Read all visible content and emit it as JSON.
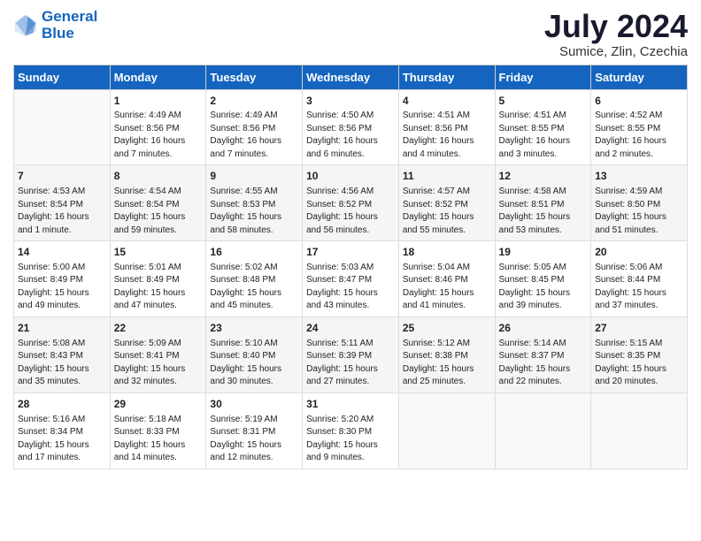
{
  "logo": {
    "line1": "General",
    "line2": "Blue"
  },
  "title": "July 2024",
  "subtitle": "Sumice, Zlin, Czechia",
  "weekdays": [
    "Sunday",
    "Monday",
    "Tuesday",
    "Wednesday",
    "Thursday",
    "Friday",
    "Saturday"
  ],
  "weeks": [
    [
      {
        "day": "",
        "sunrise": "",
        "sunset": "",
        "daylight": ""
      },
      {
        "day": "1",
        "sunrise": "Sunrise: 4:49 AM",
        "sunset": "Sunset: 8:56 PM",
        "daylight": "Daylight: 16 hours and 7 minutes."
      },
      {
        "day": "2",
        "sunrise": "Sunrise: 4:49 AM",
        "sunset": "Sunset: 8:56 PM",
        "daylight": "Daylight: 16 hours and 7 minutes."
      },
      {
        "day": "3",
        "sunrise": "Sunrise: 4:50 AM",
        "sunset": "Sunset: 8:56 PM",
        "daylight": "Daylight: 16 hours and 6 minutes."
      },
      {
        "day": "4",
        "sunrise": "Sunrise: 4:51 AM",
        "sunset": "Sunset: 8:56 PM",
        "daylight": "Daylight: 16 hours and 4 minutes."
      },
      {
        "day": "5",
        "sunrise": "Sunrise: 4:51 AM",
        "sunset": "Sunset: 8:55 PM",
        "daylight": "Daylight: 16 hours and 3 minutes."
      },
      {
        "day": "6",
        "sunrise": "Sunrise: 4:52 AM",
        "sunset": "Sunset: 8:55 PM",
        "daylight": "Daylight: 16 hours and 2 minutes."
      }
    ],
    [
      {
        "day": "7",
        "sunrise": "Sunrise: 4:53 AM",
        "sunset": "Sunset: 8:54 PM",
        "daylight": "Daylight: 16 hours and 1 minute."
      },
      {
        "day": "8",
        "sunrise": "Sunrise: 4:54 AM",
        "sunset": "Sunset: 8:54 PM",
        "daylight": "Daylight: 15 hours and 59 minutes."
      },
      {
        "day": "9",
        "sunrise": "Sunrise: 4:55 AM",
        "sunset": "Sunset: 8:53 PM",
        "daylight": "Daylight: 15 hours and 58 minutes."
      },
      {
        "day": "10",
        "sunrise": "Sunrise: 4:56 AM",
        "sunset": "Sunset: 8:52 PM",
        "daylight": "Daylight: 15 hours and 56 minutes."
      },
      {
        "day": "11",
        "sunrise": "Sunrise: 4:57 AM",
        "sunset": "Sunset: 8:52 PM",
        "daylight": "Daylight: 15 hours and 55 minutes."
      },
      {
        "day": "12",
        "sunrise": "Sunrise: 4:58 AM",
        "sunset": "Sunset: 8:51 PM",
        "daylight": "Daylight: 15 hours and 53 minutes."
      },
      {
        "day": "13",
        "sunrise": "Sunrise: 4:59 AM",
        "sunset": "Sunset: 8:50 PM",
        "daylight": "Daylight: 15 hours and 51 minutes."
      }
    ],
    [
      {
        "day": "14",
        "sunrise": "Sunrise: 5:00 AM",
        "sunset": "Sunset: 8:49 PM",
        "daylight": "Daylight: 15 hours and 49 minutes."
      },
      {
        "day": "15",
        "sunrise": "Sunrise: 5:01 AM",
        "sunset": "Sunset: 8:49 PM",
        "daylight": "Daylight: 15 hours and 47 minutes."
      },
      {
        "day": "16",
        "sunrise": "Sunrise: 5:02 AM",
        "sunset": "Sunset: 8:48 PM",
        "daylight": "Daylight: 15 hours and 45 minutes."
      },
      {
        "day": "17",
        "sunrise": "Sunrise: 5:03 AM",
        "sunset": "Sunset: 8:47 PM",
        "daylight": "Daylight: 15 hours and 43 minutes."
      },
      {
        "day": "18",
        "sunrise": "Sunrise: 5:04 AM",
        "sunset": "Sunset: 8:46 PM",
        "daylight": "Daylight: 15 hours and 41 minutes."
      },
      {
        "day": "19",
        "sunrise": "Sunrise: 5:05 AM",
        "sunset": "Sunset: 8:45 PM",
        "daylight": "Daylight: 15 hours and 39 minutes."
      },
      {
        "day": "20",
        "sunrise": "Sunrise: 5:06 AM",
        "sunset": "Sunset: 8:44 PM",
        "daylight": "Daylight: 15 hours and 37 minutes."
      }
    ],
    [
      {
        "day": "21",
        "sunrise": "Sunrise: 5:08 AM",
        "sunset": "Sunset: 8:43 PM",
        "daylight": "Daylight: 15 hours and 35 minutes."
      },
      {
        "day": "22",
        "sunrise": "Sunrise: 5:09 AM",
        "sunset": "Sunset: 8:41 PM",
        "daylight": "Daylight: 15 hours and 32 minutes."
      },
      {
        "day": "23",
        "sunrise": "Sunrise: 5:10 AM",
        "sunset": "Sunset: 8:40 PM",
        "daylight": "Daylight: 15 hours and 30 minutes."
      },
      {
        "day": "24",
        "sunrise": "Sunrise: 5:11 AM",
        "sunset": "Sunset: 8:39 PM",
        "daylight": "Daylight: 15 hours and 27 minutes."
      },
      {
        "day": "25",
        "sunrise": "Sunrise: 5:12 AM",
        "sunset": "Sunset: 8:38 PM",
        "daylight": "Daylight: 15 hours and 25 minutes."
      },
      {
        "day": "26",
        "sunrise": "Sunrise: 5:14 AM",
        "sunset": "Sunset: 8:37 PM",
        "daylight": "Daylight: 15 hours and 22 minutes."
      },
      {
        "day": "27",
        "sunrise": "Sunrise: 5:15 AM",
        "sunset": "Sunset: 8:35 PM",
        "daylight": "Daylight: 15 hours and 20 minutes."
      }
    ],
    [
      {
        "day": "28",
        "sunrise": "Sunrise: 5:16 AM",
        "sunset": "Sunset: 8:34 PM",
        "daylight": "Daylight: 15 hours and 17 minutes."
      },
      {
        "day": "29",
        "sunrise": "Sunrise: 5:18 AM",
        "sunset": "Sunset: 8:33 PM",
        "daylight": "Daylight: 15 hours and 14 minutes."
      },
      {
        "day": "30",
        "sunrise": "Sunrise: 5:19 AM",
        "sunset": "Sunset: 8:31 PM",
        "daylight": "Daylight: 15 hours and 12 minutes."
      },
      {
        "day": "31",
        "sunrise": "Sunrise: 5:20 AM",
        "sunset": "Sunset: 8:30 PM",
        "daylight": "Daylight: 15 hours and 9 minutes."
      },
      {
        "day": "",
        "sunrise": "",
        "sunset": "",
        "daylight": ""
      },
      {
        "day": "",
        "sunrise": "",
        "sunset": "",
        "daylight": ""
      },
      {
        "day": "",
        "sunrise": "",
        "sunset": "",
        "daylight": ""
      }
    ]
  ]
}
